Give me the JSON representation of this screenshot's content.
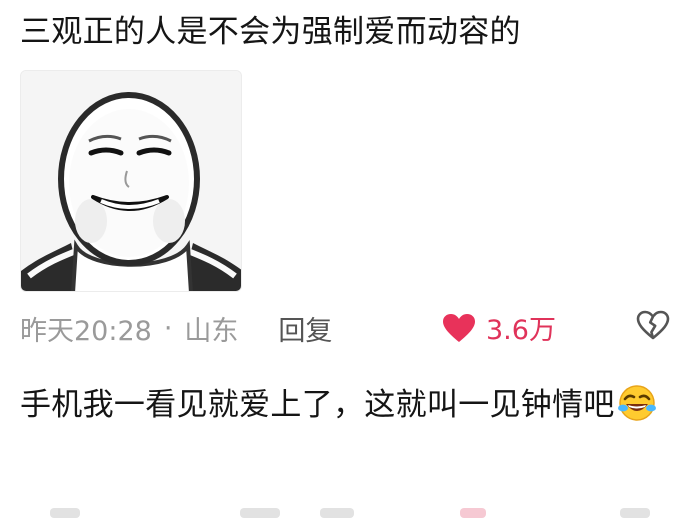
{
  "comments": [
    {
      "text": "三观正的人是不会为强制爱而动容的",
      "sticker": "smiling-face-meme-sticker",
      "time": "昨天20:28",
      "separator": "·",
      "location": "山东",
      "reply_label": "回复",
      "likes": "3.6万",
      "liked": true,
      "like_color": "#e8325a"
    },
    {
      "text": "手机我一看见就爱上了，这就叫一见钟情吧",
      "emoji": "rolling-on-floor-laughing-emoji"
    }
  ],
  "icons": {
    "like": "heart-icon",
    "dislike": "broken-heart-icon"
  },
  "colors": {
    "text": "#151515",
    "meta": "#9a9a9a",
    "reply": "#555555",
    "like": "#e0335a"
  }
}
